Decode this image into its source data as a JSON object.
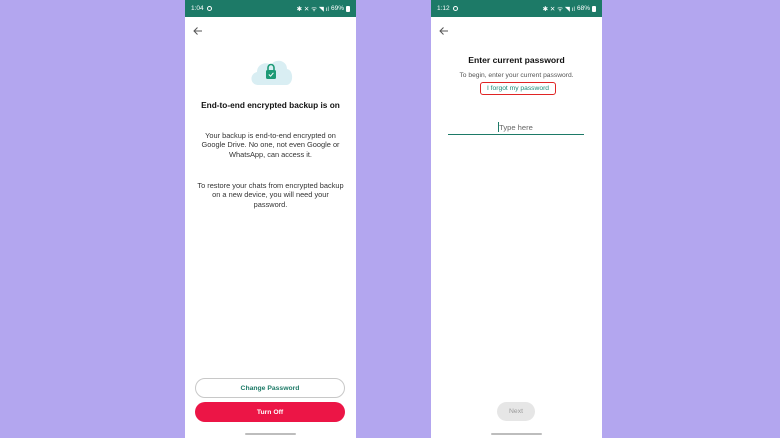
{
  "left_screen": {
    "status_bar": {
      "time": "1:04",
      "indicators": "✱ ✕ ᯤ ◥ ıl",
      "battery": "69%"
    },
    "back_icon": "arrow-left-icon",
    "cloud_icon": "cloud-lock-icon",
    "title": "End-to-end encrypted backup is on",
    "paragraph_1": "Your backup is end-to-end encrypted on Google Drive. No one, not even Google or WhatsApp, can access it.",
    "paragraph_2": "To restore your chats from encrypted backup on a new device, you will need your password.",
    "change_password_label": "Change Password",
    "turn_off_label": "Turn Off"
  },
  "right_screen": {
    "status_bar": {
      "time": "1:12",
      "indicators": "✱ ✕ ᯤ ◥ ıl",
      "battery": "68%"
    },
    "back_icon": "arrow-left-icon",
    "title": "Enter current password",
    "subtitle": "To begin, enter your current password.",
    "forgot_link": "I forgot my password",
    "password_placeholder": "Type here",
    "next_label": "Next"
  },
  "colors": {
    "background": "#b3a6ef",
    "status_bar": "#1d7a67",
    "accent_green": "#1d7a67",
    "turn_off_red": "#ec1546",
    "highlight_box": "#e02424"
  }
}
